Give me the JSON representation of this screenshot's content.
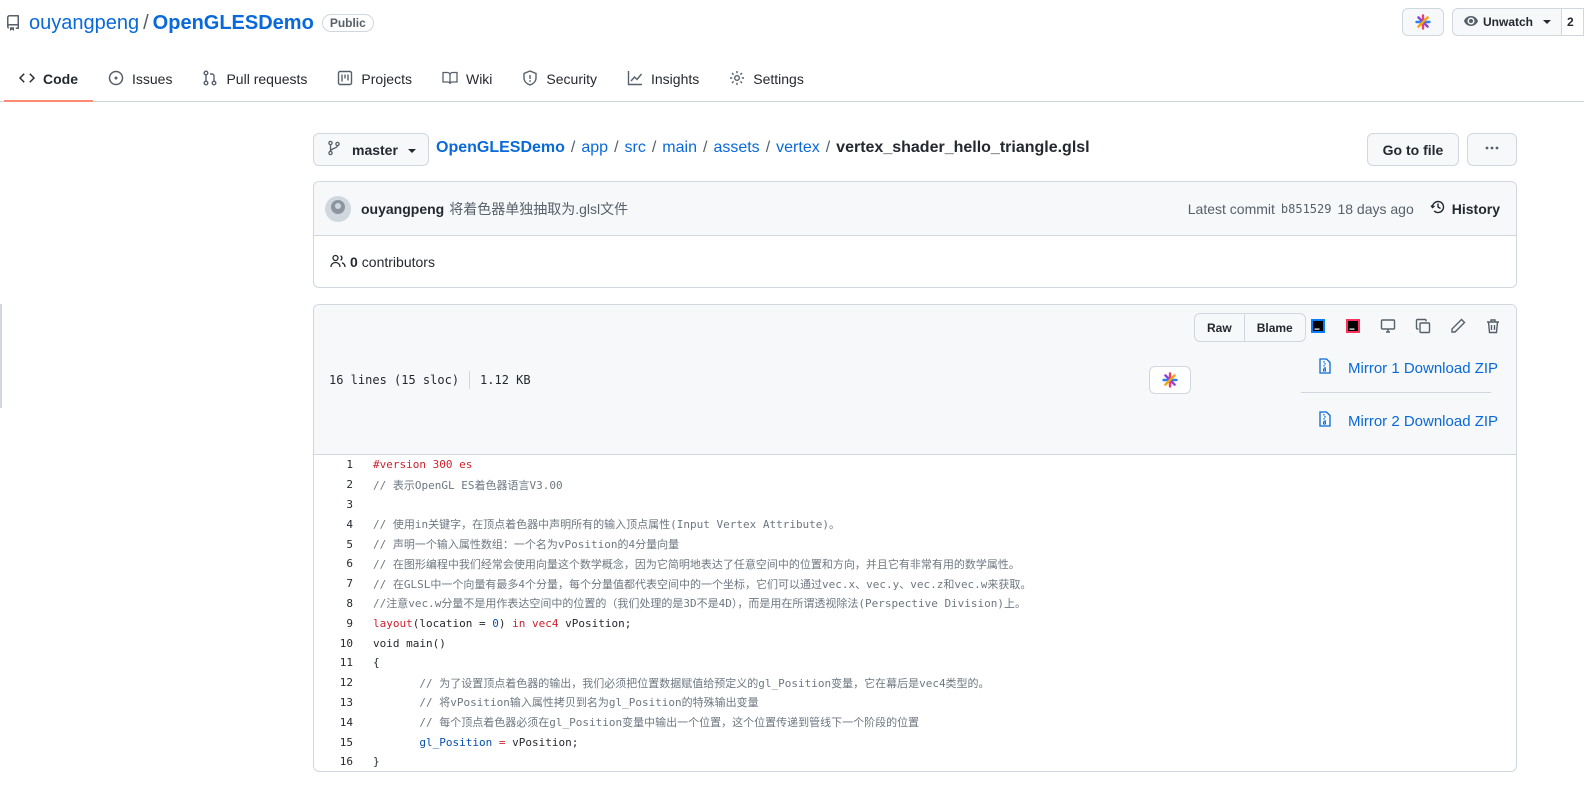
{
  "repo": {
    "owner": "ouyangpeng",
    "separator": "/",
    "name": "OpenGLESDemo",
    "visibility": "Public"
  },
  "header_actions": {
    "watch_label": "Unwatch",
    "watch_count": "2"
  },
  "tabs": [
    {
      "label": "Code",
      "icon": "code-icon",
      "active": true
    },
    {
      "label": "Issues",
      "icon": "issue-icon"
    },
    {
      "label": "Pull requests",
      "icon": "pull-request-icon"
    },
    {
      "label": "Projects",
      "icon": "project-icon"
    },
    {
      "label": "Wiki",
      "icon": "book-icon"
    },
    {
      "label": "Security",
      "icon": "shield-icon"
    },
    {
      "label": "Insights",
      "icon": "graph-icon"
    },
    {
      "label": "Settings",
      "icon": "gear-icon"
    }
  ],
  "branch": "master",
  "breadcrumb": {
    "items": [
      "OpenGLESDemo",
      "app",
      "src",
      "main",
      "assets",
      "vertex"
    ],
    "file": "vertex_shader_hello_triangle.glsl",
    "separator": "/"
  },
  "goto_file_label": "Go to file",
  "commit": {
    "author": "ouyangpeng",
    "message": "将着色器单独抽取为.glsl文件",
    "latest_label": "Latest commit",
    "sha": "b851529",
    "time": "18 days ago",
    "history_label": "History"
  },
  "contributors": {
    "count": "0",
    "label": "contributors"
  },
  "file": {
    "lines_info": "16 lines (15 sloc)",
    "size": "1.12 KB",
    "raw_label": "Raw",
    "blame_label": "Blame",
    "mirror1": "Mirror 1 Download ZIP",
    "mirror2": "Mirror 2 Download ZIP"
  },
  "code_lines": [
    {
      "n": "1",
      "text": "#version 300 es"
    },
    {
      "n": "2",
      "text": "// 表示OpenGL ES着色器语言V3.00"
    },
    {
      "n": "3",
      "text": ""
    },
    {
      "n": "4",
      "text": "// 使用in关键字，在顶点着色器中声明所有的输入顶点属性(Input Vertex Attribute)。"
    },
    {
      "n": "5",
      "text": "// 声明一个输入属性数组：一个名为vPosition的4分量向量"
    },
    {
      "n": "6",
      "text": "// 在图形编程中我们经常会使用向量这个数学概念，因为它简明地表达了任意空间中的位置和方向，并且它有非常有用的数学属性。"
    },
    {
      "n": "7",
      "text": "// 在GLSL中一个向量有最多4个分量，每个分量值都代表空间中的一个坐标，它们可以通过vec.x、vec.y、vec.z和vec.w来获取。"
    },
    {
      "n": "8",
      "text": "//注意vec.w分量不是用作表达空间中的位置的（我们处理的是3D不是4D），而是用在所谓透视除法(Perspective Division)上。"
    },
    {
      "n": "9",
      "text": "layout(location = 0) in vec4 vPosition;"
    },
    {
      "n": "10",
      "text": "void main()"
    },
    {
      "n": "11",
      "text": "{"
    },
    {
      "n": "12",
      "text": "       // 为了设置顶点着色器的输出，我们必须把位置数据赋值给预定义的gl_Position变量，它在幕后是vec4类型的。"
    },
    {
      "n": "13",
      "text": "       // 将vPosition输入属性拷贝到名为gl_Position的特殊输出变量"
    },
    {
      "n": "14",
      "text": "       // 每个顶点着色器必须在gl_Position变量中输出一个位置，这个位置传递到管线下一个阶段的位置"
    },
    {
      "n": "15",
      "text": "       gl_Position = vPosition;"
    },
    {
      "n": "16",
      "text": "}"
    }
  ]
}
